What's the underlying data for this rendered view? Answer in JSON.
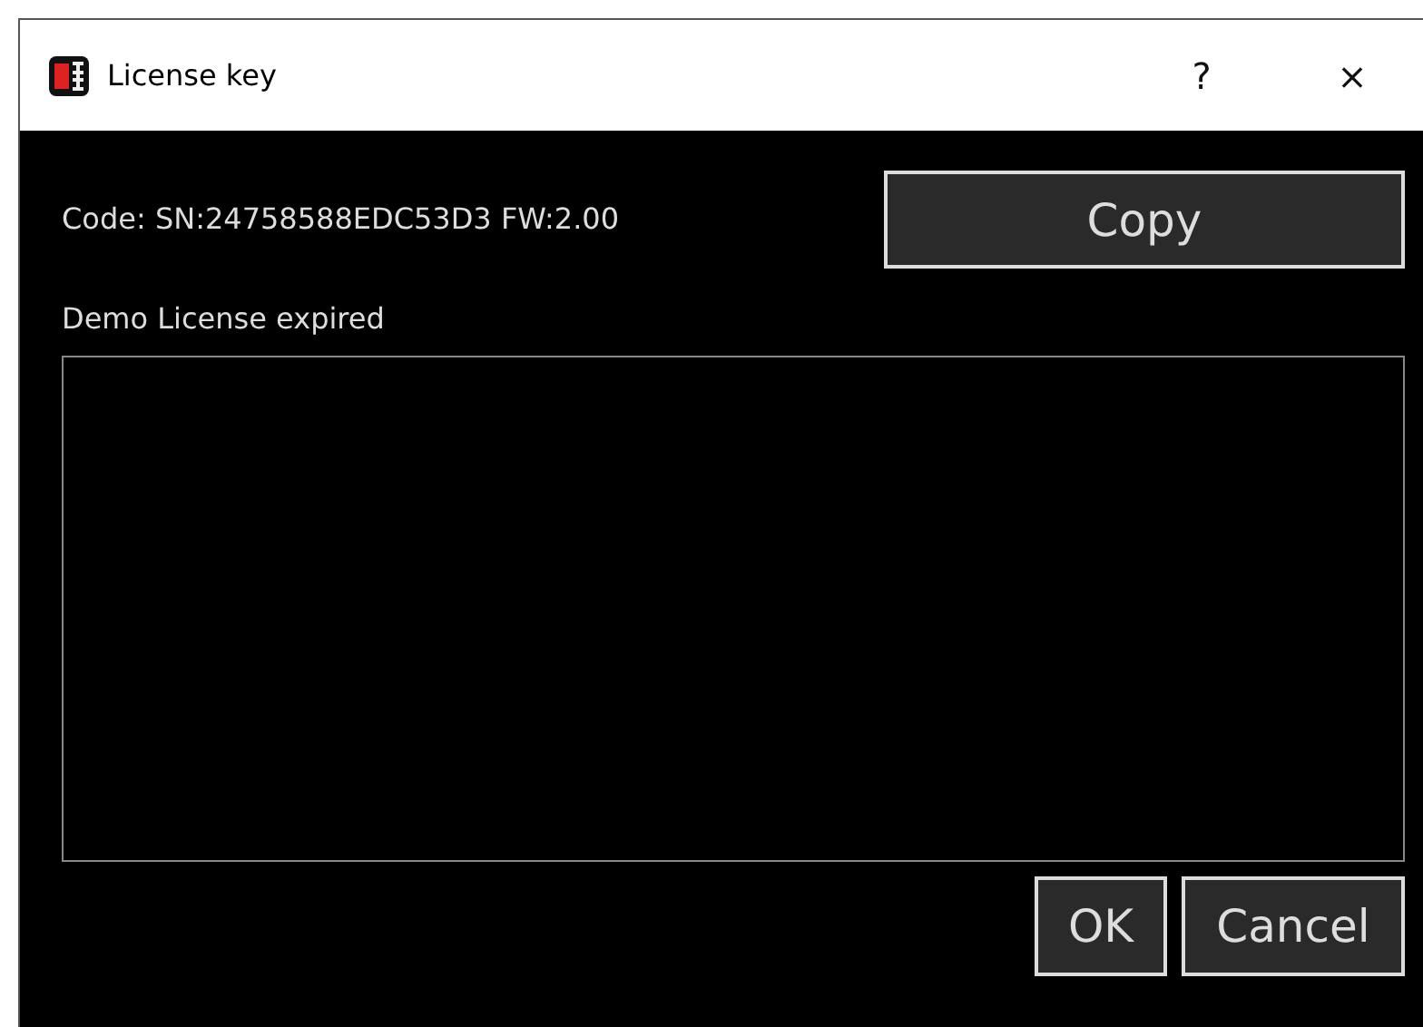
{
  "window": {
    "title": "License key",
    "help": "?",
    "close": "×"
  },
  "code_label": "Code: SN:24758588EDC53D3 FW:2.00",
  "copy_button": "Copy",
  "status": "Demo License expired",
  "buttons": [
    "OK",
    "Cancel"
  ]
}
